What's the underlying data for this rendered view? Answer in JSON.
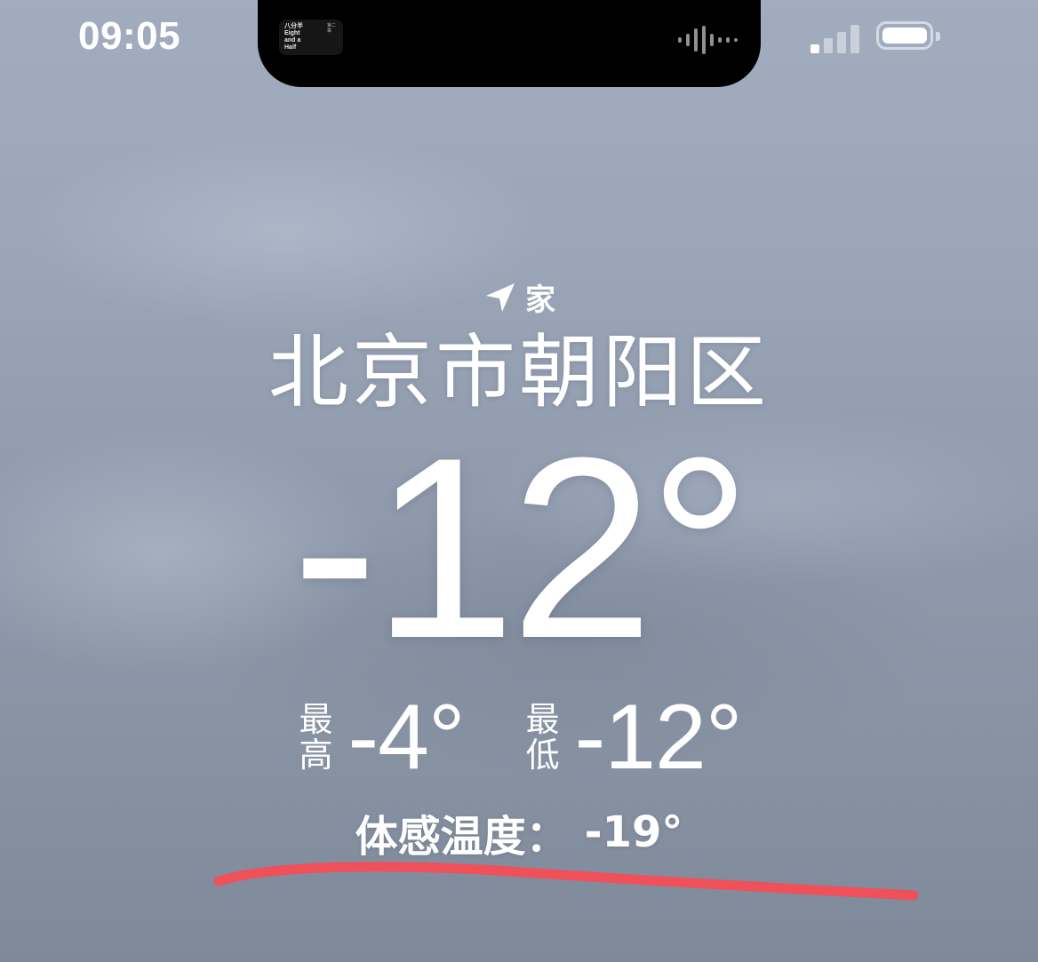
{
  "status_bar": {
    "time": "09:05",
    "now_playing_art": "八分半\nEight\nand a\nHalf",
    "now_playing_sub": "第二\n章 ",
    "signal_bars_on": 1,
    "signal_bars_total": 4
  },
  "weather": {
    "location_tag": "家",
    "location_icon": "location-arrow-icon",
    "city": "北京市朝阳区",
    "current_temp": "-12°",
    "high_label_top": "最",
    "high_label_bottom": "高",
    "high_value": "-4°",
    "low_label_top": "最",
    "low_label_bottom": "低",
    "low_value": "-12°",
    "feels_like_label": "体感温度：",
    "feels_like_value": "-19°"
  },
  "annotation": {
    "underline_color": "#f0505a"
  }
}
